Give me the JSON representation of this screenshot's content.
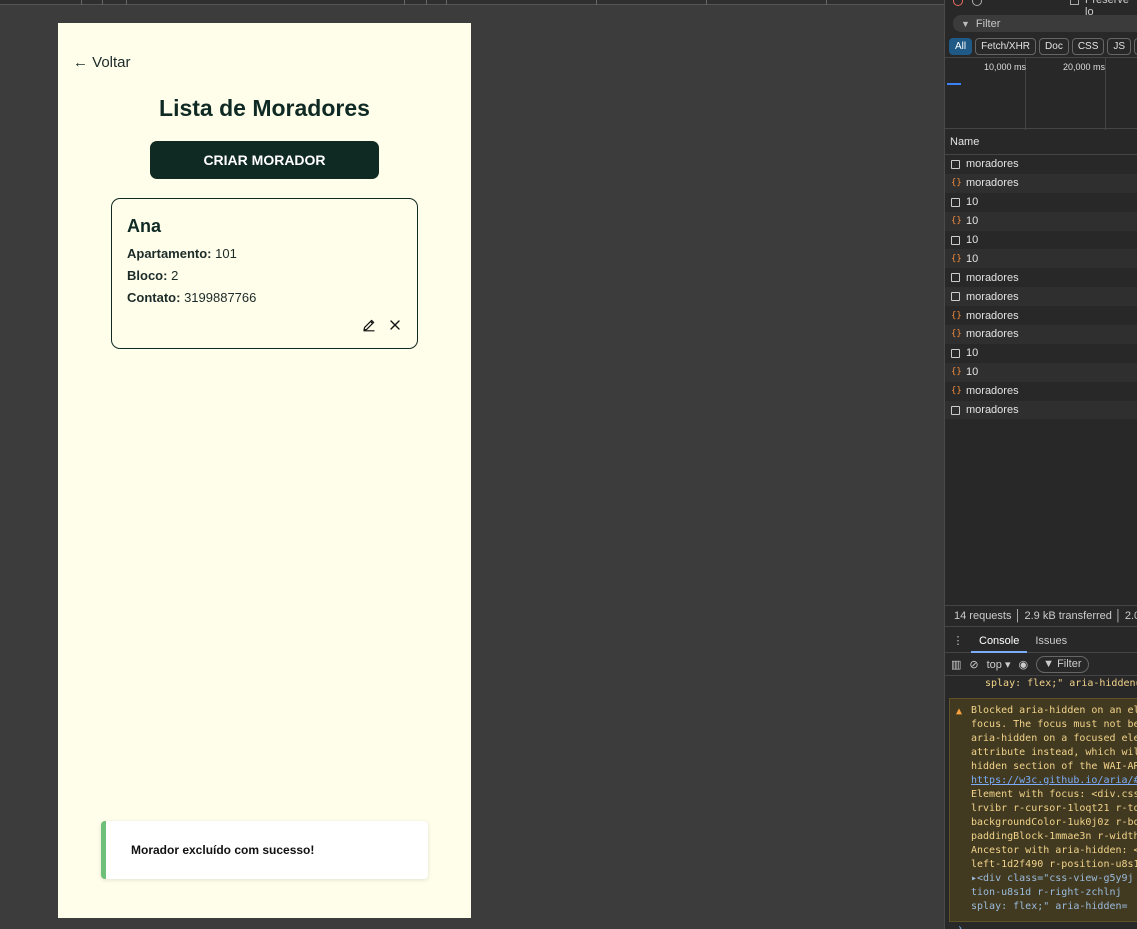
{
  "app": {
    "back_label": "← Voltar",
    "title": "Lista de Moradores",
    "create_button": "CRIAR MORADOR",
    "card": {
      "name": "Ana",
      "apartment_label": "Apartamento:",
      "apartment_value": "101",
      "block_label": "Bloco:",
      "block_value": "2",
      "contact_label": "Contato:",
      "contact_value": "3199887766",
      "edit_icon": "pencil-icon",
      "delete_icon": "close-icon"
    },
    "toast": "Morador excluído com sucesso!",
    "accent_dark": "#0f2a22",
    "toast_accent": "#6dbf7a",
    "page_bg": "#fffeeb"
  },
  "devtools": {
    "preserve_label": "Preserve lo",
    "filter_placeholder": "Filter",
    "types": [
      "All",
      "Fetch/XHR",
      "Doc",
      "CSS",
      "JS",
      "F"
    ],
    "timeline": [
      "10,000 ms",
      "20,000 ms"
    ],
    "name_header": "Name",
    "requests": [
      {
        "type": "doc",
        "name": "moradores"
      },
      {
        "type": "json",
        "name": "moradores"
      },
      {
        "type": "doc",
        "name": "10"
      },
      {
        "type": "json",
        "name": "10"
      },
      {
        "type": "doc",
        "name": "10"
      },
      {
        "type": "json",
        "name": "10"
      },
      {
        "type": "doc",
        "name": "moradores"
      },
      {
        "type": "doc",
        "name": "moradores"
      },
      {
        "type": "json",
        "name": "moradores"
      },
      {
        "type": "json",
        "name": "moradores"
      },
      {
        "type": "doc",
        "name": "10"
      },
      {
        "type": "json",
        "name": "10"
      },
      {
        "type": "json",
        "name": "moradores"
      },
      {
        "type": "doc",
        "name": "moradores"
      }
    ],
    "summary": "14 requests │ 2.9 kB transferred │ 2.0",
    "console_tab": "Console",
    "issues_tab": "Issues",
    "context": "top ▾",
    "filter_btn": "Filter",
    "console_first": "splay: flex;\" aria-hidden=",
    "warning_lines": [
      "Blocked aria-hidden on an el",
      "focus. The focus must not be",
      "aria-hidden on a focused ele",
      "attribute instead, which wil",
      "hidden section of the WAI-AR",
      "https://w3c.github.io/aria/#",
      "Element with focus: <div.css",
      "lrvibr r-cursor-1loqt21 r-to",
      "backgroundColor-1uk0j0z r-bo",
      "paddingBlock-1mmae3n r-width",
      "Ancestor with aria-hidden: <",
      "left-1d2f490 r-position-u8s1",
      "▸<div class=\"css-view-g5y9j",
      " tion-u8s1d r-right-zchlnj",
      " splay: flex;\" aria-hidden="
    ]
  }
}
